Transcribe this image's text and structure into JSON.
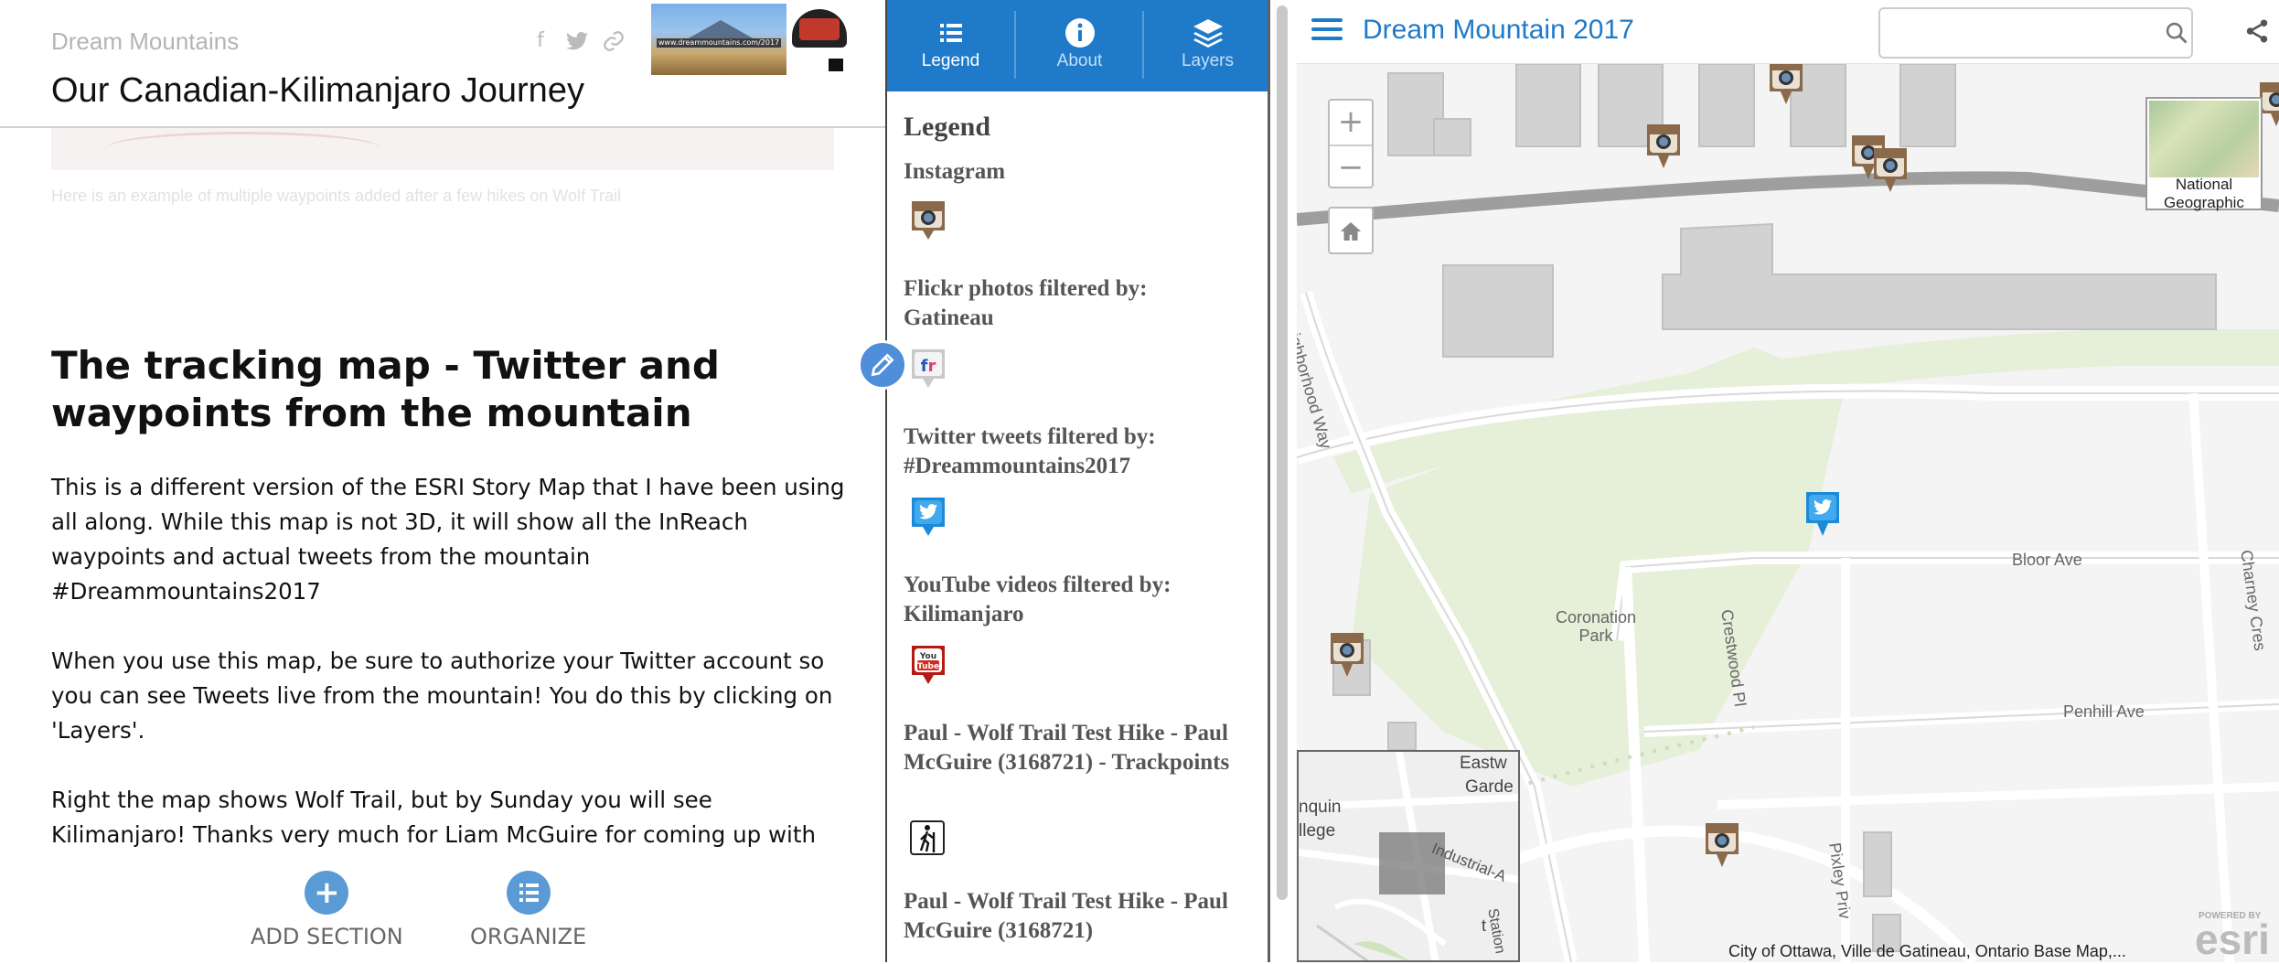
{
  "story": {
    "site_title": "Dream Mountains",
    "title": "Our Canadian-Kilimanjaro Journey",
    "banner_url": "www.dreammountains.com/2017",
    "faded_caption": "Here is an example of multiple waypoints added after a few hikes on Wolf Trail",
    "section_heading": "The tracking map - Twitter and waypoints from the mountain",
    "paragraphs": [
      "This is a different version of the ESRI Story Map that I have been using all along. While this map is not 3D, it will show all the InReach waypoints and actual tweets from the mountain #Dreammountains2017",
      "When you use this map, be sure to authorize your Twitter account so you can see Tweets live from the mountain! You do this by clicking on 'Layers'.",
      "Right the map shows Wolf Trail, but by Sunday you will see Kilimanjaro! Thanks very much for Liam McGuire for coming up with"
    ],
    "add_section_label": "ADD SECTION",
    "organize_label": "ORGANIZE",
    "share_icons": [
      "facebook-icon",
      "twitter-icon",
      "link-icon"
    ]
  },
  "legend_panel": {
    "tabs": [
      {
        "label": "Legend",
        "icon": "list-icon",
        "active": true
      },
      {
        "label": "About",
        "icon": "info-icon",
        "active": false
      },
      {
        "label": "Layers",
        "icon": "layers-icon",
        "active": false
      }
    ],
    "heading": "Legend",
    "layers": [
      {
        "label": "Instagram",
        "symbol": "instagram-camera-icon"
      },
      {
        "label": "Flickr photos filtered by: Gatineau",
        "symbol": "flickr-icon",
        "symbol_text": "fr"
      },
      {
        "label": "Twitter tweets filtered by: #Dreammountains2017",
        "symbol": "twitter-bird-icon"
      },
      {
        "label": "YouTube videos filtered by: Kilimanjaro",
        "symbol": "youtube-icon",
        "symbol_text": "You Tube"
      },
      {
        "label": "Paul - Wolf Trail Test Hike - Paul McGuire (3168721) - Trackpoints",
        "symbol": "hiker-icon"
      },
      {
        "label": "Paul - Wolf Trail Test Hike - Paul McGuire (3168721)",
        "symbol": ""
      }
    ]
  },
  "map": {
    "title": "Dream Mountain 2017",
    "search_placeholder": "",
    "zoom_in": "+",
    "zoom_out": "−",
    "basemap_label": "National Geographic",
    "overview_labels": [
      "Eastw",
      "Garde",
      "nquin",
      "llege",
      "Industrial-A",
      "Station",
      "t"
    ],
    "labels": [
      "Neighborhood Way",
      "Bloor Ave",
      "Coronation Park",
      "Crestwood Pl",
      "Penhill Ave",
      "Pixley Priv",
      "Charney Cres"
    ],
    "attribution": "City of Ottawa, Ville de Gatineau, Ontario Base Map,...",
    "esri_powered": "POWERED BY",
    "esri_text": "esri",
    "colors": {
      "accent": "#1f7ac9",
      "park": "#e6efd8",
      "road": "#ffffff",
      "building": "#d2d2d2"
    }
  }
}
